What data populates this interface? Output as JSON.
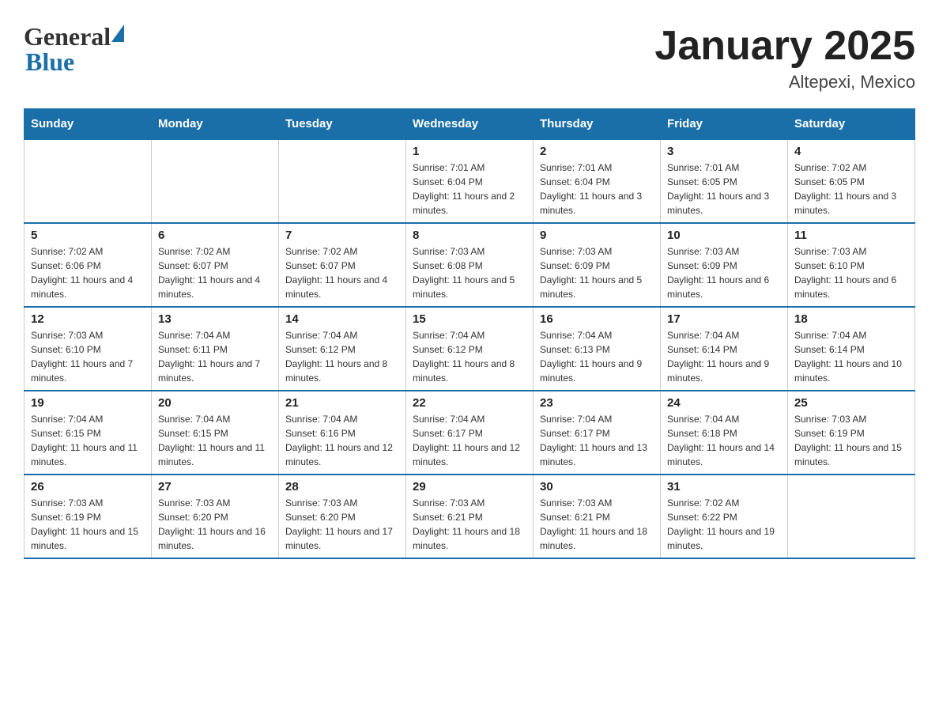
{
  "logo": {
    "general": "General",
    "blue": "Blue"
  },
  "title": "January 2025",
  "subtitle": "Altepexi, Mexico",
  "weekdays": [
    "Sunday",
    "Monday",
    "Tuesday",
    "Wednesday",
    "Thursday",
    "Friday",
    "Saturday"
  ],
  "weeks": [
    [
      {
        "day": "",
        "info": ""
      },
      {
        "day": "",
        "info": ""
      },
      {
        "day": "",
        "info": ""
      },
      {
        "day": "1",
        "info": "Sunrise: 7:01 AM\nSunset: 6:04 PM\nDaylight: 11 hours and 2 minutes."
      },
      {
        "day": "2",
        "info": "Sunrise: 7:01 AM\nSunset: 6:04 PM\nDaylight: 11 hours and 3 minutes."
      },
      {
        "day": "3",
        "info": "Sunrise: 7:01 AM\nSunset: 6:05 PM\nDaylight: 11 hours and 3 minutes."
      },
      {
        "day": "4",
        "info": "Sunrise: 7:02 AM\nSunset: 6:05 PM\nDaylight: 11 hours and 3 minutes."
      }
    ],
    [
      {
        "day": "5",
        "info": "Sunrise: 7:02 AM\nSunset: 6:06 PM\nDaylight: 11 hours and 4 minutes."
      },
      {
        "day": "6",
        "info": "Sunrise: 7:02 AM\nSunset: 6:07 PM\nDaylight: 11 hours and 4 minutes."
      },
      {
        "day": "7",
        "info": "Sunrise: 7:02 AM\nSunset: 6:07 PM\nDaylight: 11 hours and 4 minutes."
      },
      {
        "day": "8",
        "info": "Sunrise: 7:03 AM\nSunset: 6:08 PM\nDaylight: 11 hours and 5 minutes."
      },
      {
        "day": "9",
        "info": "Sunrise: 7:03 AM\nSunset: 6:09 PM\nDaylight: 11 hours and 5 minutes."
      },
      {
        "day": "10",
        "info": "Sunrise: 7:03 AM\nSunset: 6:09 PM\nDaylight: 11 hours and 6 minutes."
      },
      {
        "day": "11",
        "info": "Sunrise: 7:03 AM\nSunset: 6:10 PM\nDaylight: 11 hours and 6 minutes."
      }
    ],
    [
      {
        "day": "12",
        "info": "Sunrise: 7:03 AM\nSunset: 6:10 PM\nDaylight: 11 hours and 7 minutes."
      },
      {
        "day": "13",
        "info": "Sunrise: 7:04 AM\nSunset: 6:11 PM\nDaylight: 11 hours and 7 minutes."
      },
      {
        "day": "14",
        "info": "Sunrise: 7:04 AM\nSunset: 6:12 PM\nDaylight: 11 hours and 8 minutes."
      },
      {
        "day": "15",
        "info": "Sunrise: 7:04 AM\nSunset: 6:12 PM\nDaylight: 11 hours and 8 minutes."
      },
      {
        "day": "16",
        "info": "Sunrise: 7:04 AM\nSunset: 6:13 PM\nDaylight: 11 hours and 9 minutes."
      },
      {
        "day": "17",
        "info": "Sunrise: 7:04 AM\nSunset: 6:14 PM\nDaylight: 11 hours and 9 minutes."
      },
      {
        "day": "18",
        "info": "Sunrise: 7:04 AM\nSunset: 6:14 PM\nDaylight: 11 hours and 10 minutes."
      }
    ],
    [
      {
        "day": "19",
        "info": "Sunrise: 7:04 AM\nSunset: 6:15 PM\nDaylight: 11 hours and 11 minutes."
      },
      {
        "day": "20",
        "info": "Sunrise: 7:04 AM\nSunset: 6:15 PM\nDaylight: 11 hours and 11 minutes."
      },
      {
        "day": "21",
        "info": "Sunrise: 7:04 AM\nSunset: 6:16 PM\nDaylight: 11 hours and 12 minutes."
      },
      {
        "day": "22",
        "info": "Sunrise: 7:04 AM\nSunset: 6:17 PM\nDaylight: 11 hours and 12 minutes."
      },
      {
        "day": "23",
        "info": "Sunrise: 7:04 AM\nSunset: 6:17 PM\nDaylight: 11 hours and 13 minutes."
      },
      {
        "day": "24",
        "info": "Sunrise: 7:04 AM\nSunset: 6:18 PM\nDaylight: 11 hours and 14 minutes."
      },
      {
        "day": "25",
        "info": "Sunrise: 7:03 AM\nSunset: 6:19 PM\nDaylight: 11 hours and 15 minutes."
      }
    ],
    [
      {
        "day": "26",
        "info": "Sunrise: 7:03 AM\nSunset: 6:19 PM\nDaylight: 11 hours and 15 minutes."
      },
      {
        "day": "27",
        "info": "Sunrise: 7:03 AM\nSunset: 6:20 PM\nDaylight: 11 hours and 16 minutes."
      },
      {
        "day": "28",
        "info": "Sunrise: 7:03 AM\nSunset: 6:20 PM\nDaylight: 11 hours and 17 minutes."
      },
      {
        "day": "29",
        "info": "Sunrise: 7:03 AM\nSunset: 6:21 PM\nDaylight: 11 hours and 18 minutes."
      },
      {
        "day": "30",
        "info": "Sunrise: 7:03 AM\nSunset: 6:21 PM\nDaylight: 11 hours and 18 minutes."
      },
      {
        "day": "31",
        "info": "Sunrise: 7:02 AM\nSunset: 6:22 PM\nDaylight: 11 hours and 19 minutes."
      },
      {
        "day": "",
        "info": ""
      }
    ]
  ]
}
